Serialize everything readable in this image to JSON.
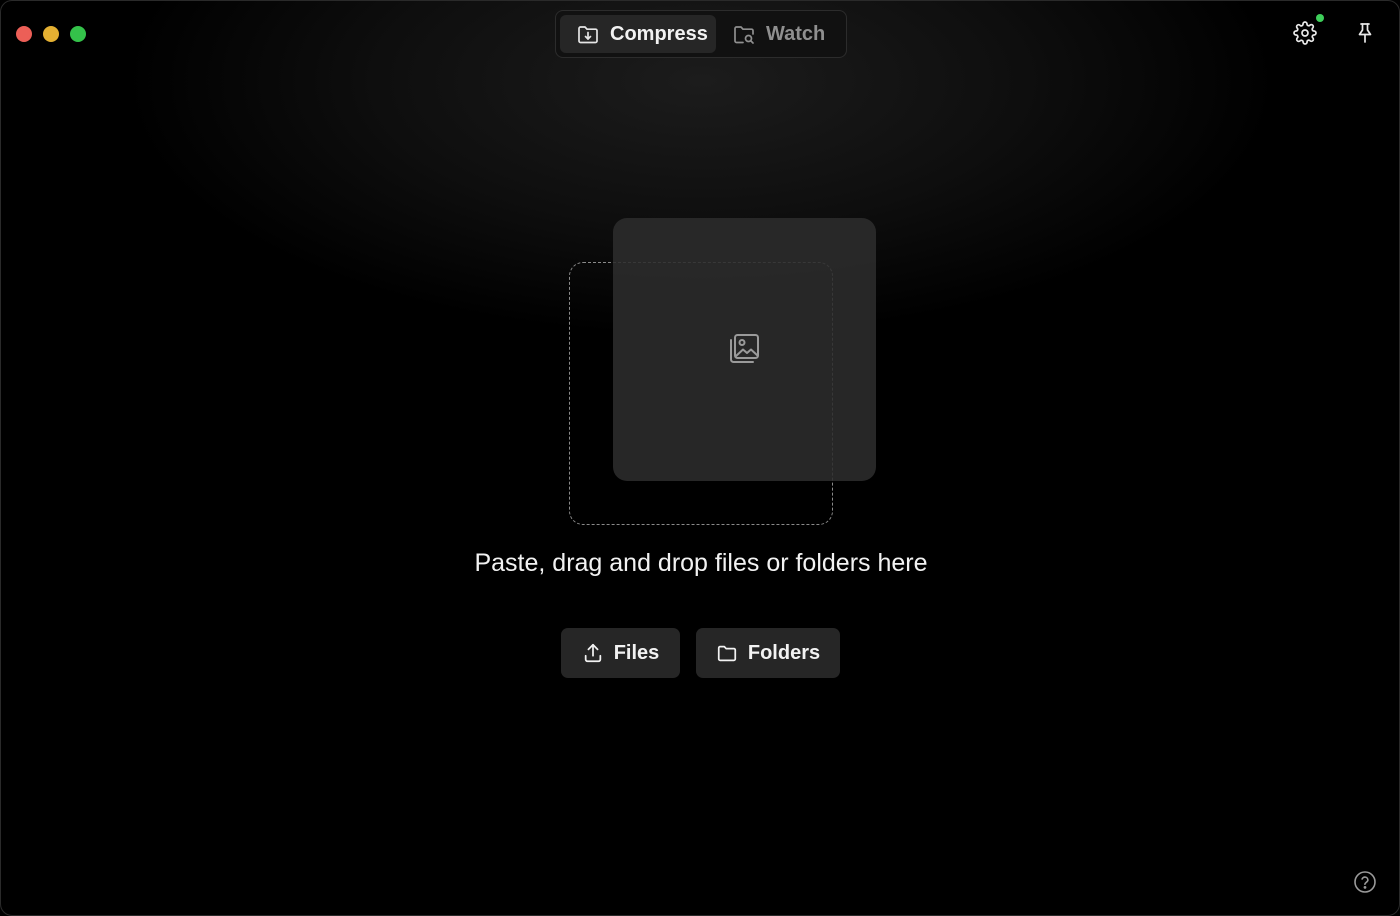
{
  "window": {
    "traffic_lights": [
      "close",
      "minimize",
      "maximize"
    ]
  },
  "tabs": [
    {
      "label": "Compress",
      "icon": "folder-download-icon",
      "active": true
    },
    {
      "label": "Watch",
      "icon": "folder-search-icon",
      "active": false
    }
  ],
  "toolbar": {
    "settings_icon": "gear-icon",
    "settings_badge_color": "#3ecf5a",
    "pin_icon": "pin-icon"
  },
  "dropzone": {
    "icon": "image-gallery-icon",
    "text": "Paste, drag and drop files or folders here"
  },
  "actions": {
    "files_label": "Files",
    "files_icon": "upload-icon",
    "folders_label": "Folders",
    "folders_icon": "folder-icon"
  },
  "footer": {
    "help_icon": "help-circle-icon"
  }
}
